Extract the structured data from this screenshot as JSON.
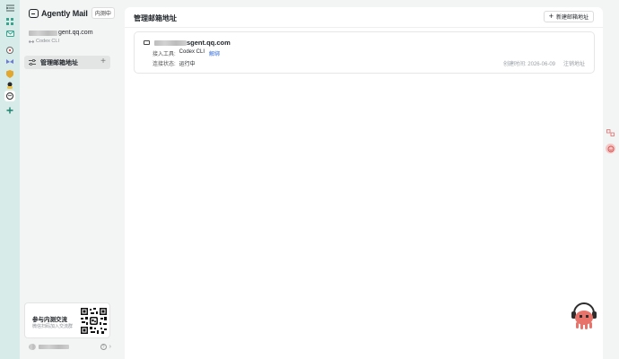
{
  "brand": {
    "name": "Agently Mail",
    "badge": "内测中"
  },
  "account": {
    "email_suffix": "gent.qq.com",
    "tool": "Codex CLI"
  },
  "sidebar": {
    "items": [
      {
        "label": "管理邮箱地址"
      }
    ]
  },
  "qr_card": {
    "title": "参与内测交流",
    "subtitle": "微信扫码加入交流群"
  },
  "main": {
    "title": "管理邮箱地址",
    "new_button": "新建邮箱地址",
    "mailboxes": [
      {
        "email_suffix": "sgent.qq.com",
        "tool_label": "接入工具:",
        "tool_value": "Codex CLI",
        "unbind_label": "解绑",
        "status_label": "连接状态:",
        "status_value": "运行中",
        "created_label": "创建时间:",
        "created_value": "2026-06-09",
        "revoke_label": "注销地址"
      }
    ]
  },
  "user": {
    "help_glyph": "?",
    "chevron": "›"
  },
  "colors": {
    "rail": "#d7ece8",
    "accent": "#2f6bd9",
    "mascot": "#e8736a"
  }
}
